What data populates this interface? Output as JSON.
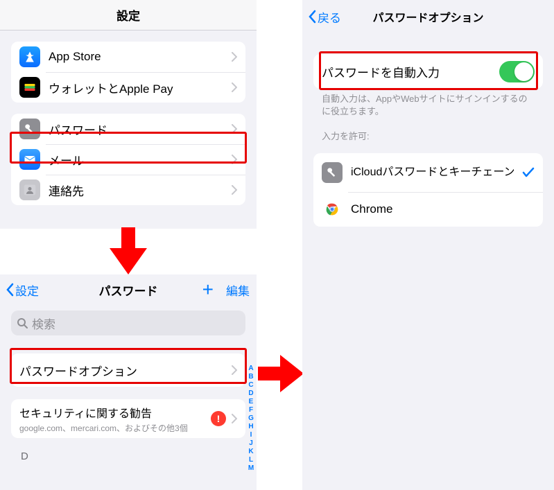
{
  "settings": {
    "title": "設定",
    "group1": {
      "appstore": "App Store",
      "wallet": "ウォレットとApple Pay"
    },
    "group2": {
      "password": "パスワード",
      "mail": "メール",
      "contacts": "連絡先"
    }
  },
  "passwords": {
    "back": "設定",
    "title": "パスワード",
    "edit": "編集",
    "search_placeholder": "検索",
    "options_row": "パスワードオプション",
    "security": {
      "title": "セキュリティに関する勧告",
      "subtitle": "google.com、mercari.com、およびその他3個",
      "badge": "!"
    },
    "index_letters": [
      "A",
      "B",
      "C",
      "D",
      "E",
      "F",
      "G",
      "H",
      "I",
      "J",
      "K",
      "L",
      "M"
    ],
    "section_letter": "D"
  },
  "options": {
    "back": "戻る",
    "title": "パスワードオプション",
    "autofill_label": "パスワードを自動入力",
    "autofill_on": true,
    "caption": "自動入力は、AppやWebサイトにサインインするのに役立ちます。",
    "allow_header": "入力を許可:",
    "sources": {
      "icloud": "iCloudパスワードとキーチェーン",
      "chrome": "Chrome"
    }
  }
}
